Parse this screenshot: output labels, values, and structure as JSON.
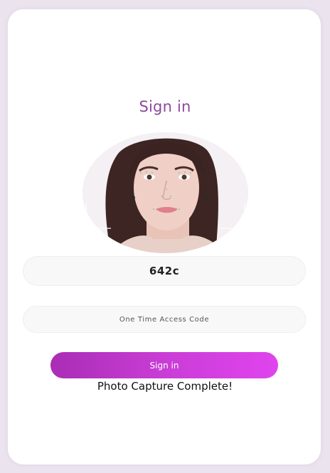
{
  "form": {
    "title": "Sign in",
    "access_id_value": "642c",
    "otp_placeholder": "One Time Access Code",
    "submit_label": "Sign in",
    "status_message": "Photo Capture Complete!"
  },
  "colors": {
    "page_background": "#ebe3ee",
    "card_background": "#ffffff",
    "title_color": "#8c4a9b",
    "button_gradient_start": "#a92db5",
    "button_gradient_end": "#e044ee"
  },
  "icons": {
    "captured_photo": "face-photo"
  }
}
